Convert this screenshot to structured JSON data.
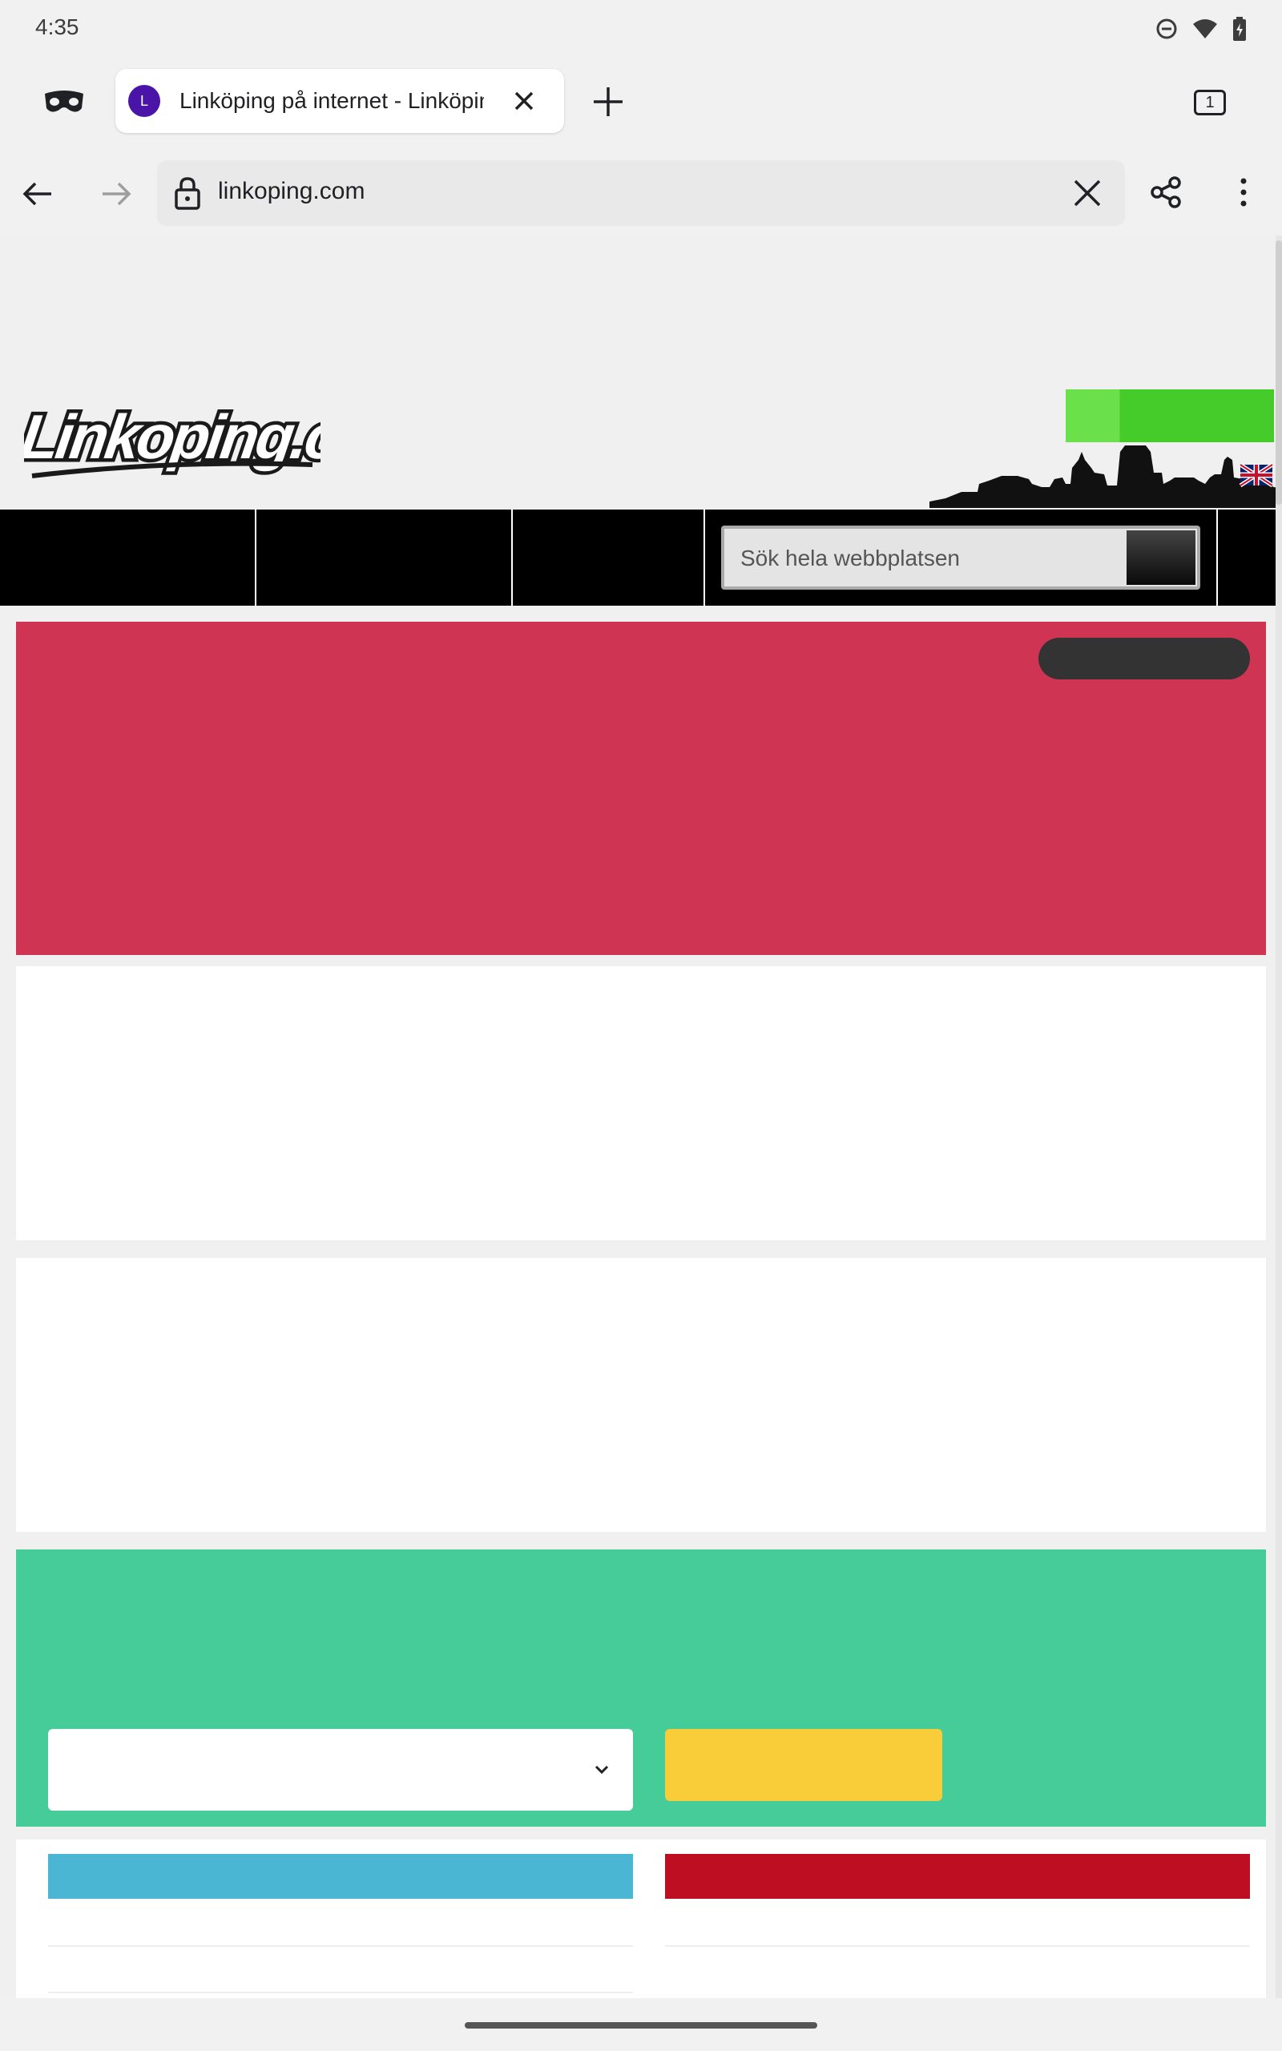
{
  "status_bar": {
    "time": "4:35",
    "icons": [
      "do-not-disturb-icon",
      "wifi-icon",
      "battery-icon"
    ]
  },
  "browser": {
    "tab": {
      "favicon_letter": "L",
      "title": "Linköping på internet - Linköping.com",
      "favicon_color": "#4a14a8"
    },
    "tab_count": "1",
    "url": "linkoping.com"
  },
  "page": {
    "search": {
      "placeholder": "Sök hela webbplatsen"
    },
    "colors": {
      "banner_red": "#cf3553",
      "panel_green": "#45cc98",
      "button_yellow": "#f9cc3a",
      "bar_blue": "#4ab6d4",
      "bar_crimson": "#be0e22",
      "lang_green": "#46cc2a"
    }
  }
}
